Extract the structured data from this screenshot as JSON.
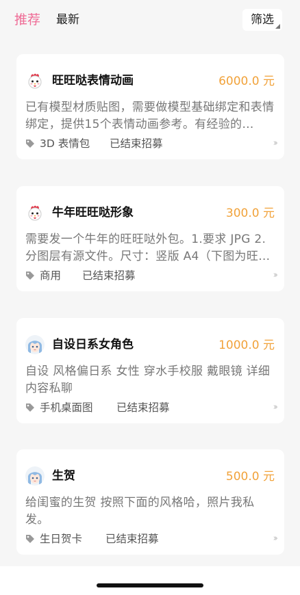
{
  "tabs": [
    {
      "label": "推荐",
      "active": true
    },
    {
      "label": "最新",
      "active": false
    }
  ],
  "filter_label": "筛选",
  "accent_color": "#ef6c96",
  "price_color": "#f1a23a",
  "cards": [
    {
      "avatar": "rooster-avatar-icon",
      "title": "旺旺哒表情动画",
      "price": "6000.0 元",
      "description": "已有模型材质贴图，需要做模型基础绑定和表情绑定，提供15个表情动画参考。有经验的…",
      "tag": "3D 表情包",
      "status": "已结束招募"
    },
    {
      "avatar": "rooster-avatar-icon",
      "title": "牛年旺旺哒形象",
      "price": "300.0 元",
      "description": "需要发一个牛年的旺旺哒外包。1.要求 JPG  2.分图层有源文件。尺寸：竖版 A4（下图为旺…",
      "tag": "商用",
      "status": "已结束招募"
    },
    {
      "avatar": "anime-girl-avatar-icon",
      "title": "自设日系女角色",
      "price": "1000.0 元",
      "description": "自设 风格偏日系 女性 穿水手校服 戴眼镜  详细内容私聊",
      "tag": "手机桌面图",
      "status": "已结束招募"
    },
    {
      "avatar": "anime-girl-avatar-icon",
      "title": "生贺",
      "price": "500.0 元",
      "description": "给闺蜜的生贺 按照下面的风格哈，照片我私发。",
      "tag": "生日贺卡",
      "status": "已结束招募"
    }
  ]
}
